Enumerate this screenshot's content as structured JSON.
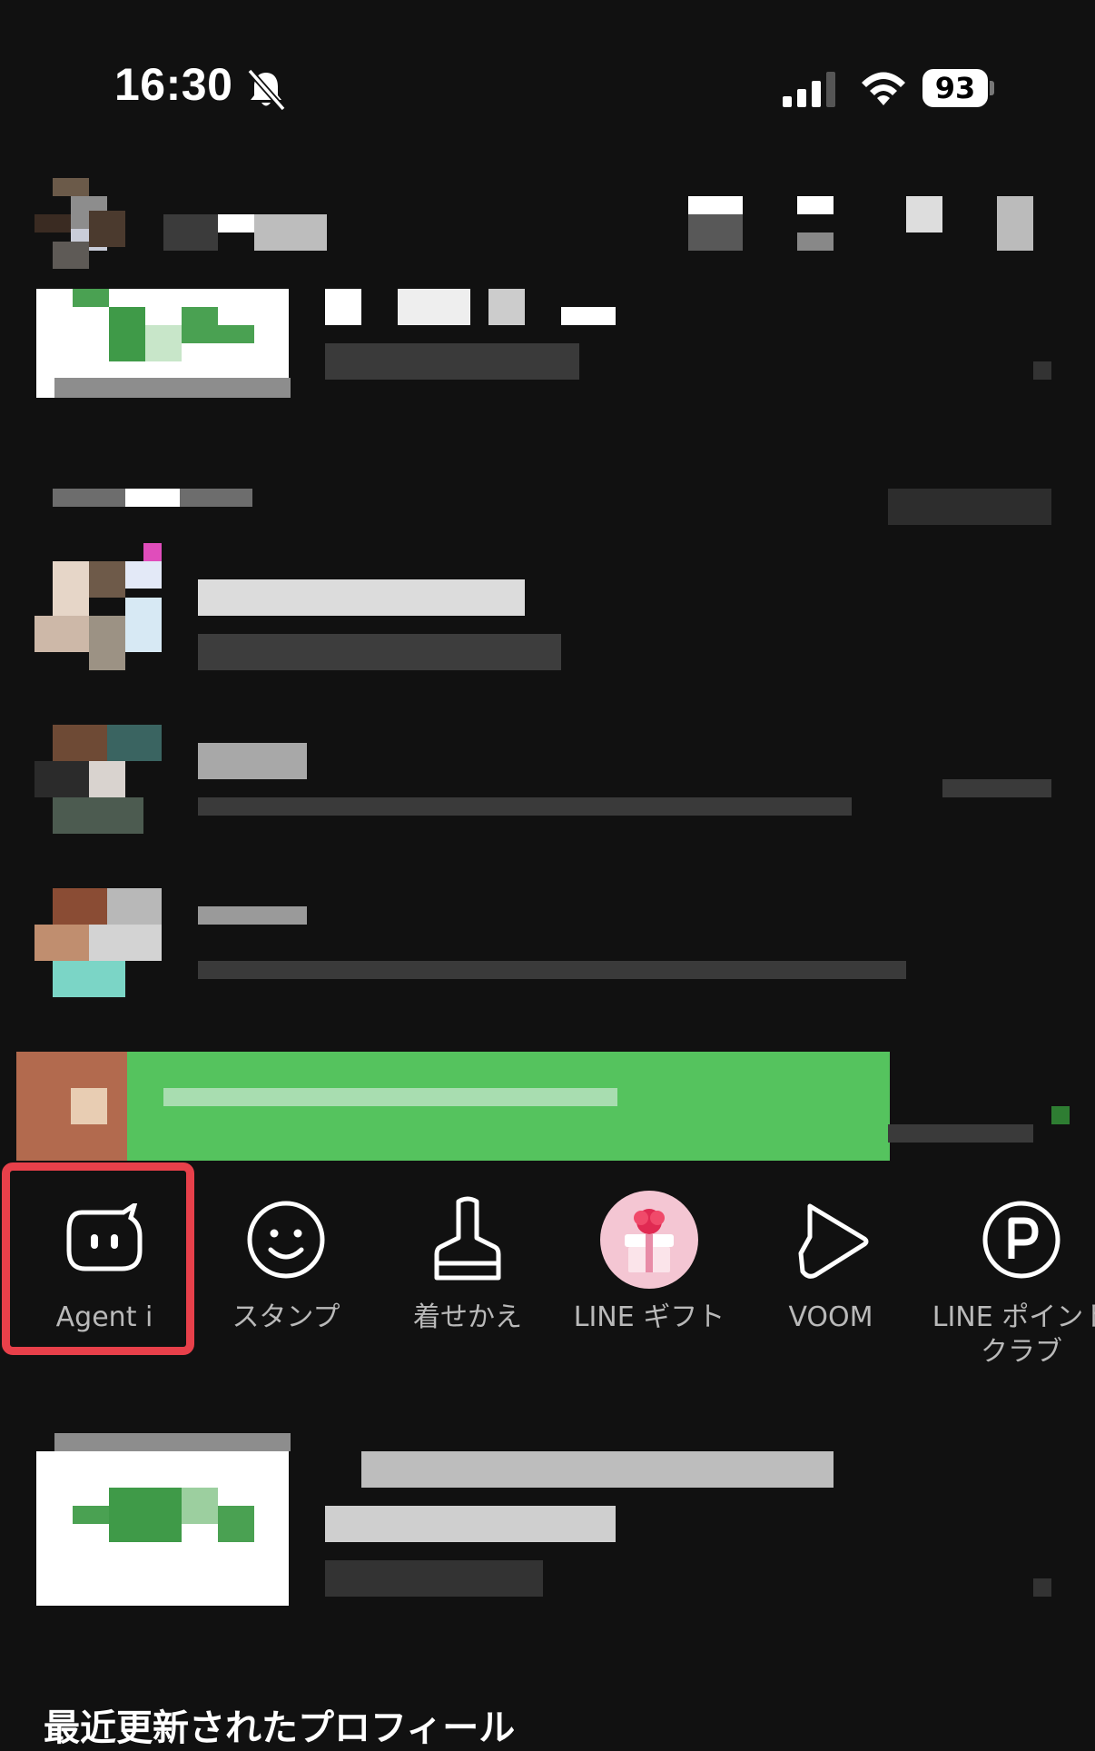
{
  "status_bar": {
    "time": "16:30",
    "battery": "93"
  },
  "services": [
    {
      "label": "Agent i",
      "icon": "agent-i-icon"
    },
    {
      "label": "スタンプ",
      "icon": "smiley-icon"
    },
    {
      "label": "着せかえ",
      "icon": "brush-icon"
    },
    {
      "label": "LINE ギフト",
      "icon": "gift-icon"
    },
    {
      "label": "VOOM",
      "icon": "voom-play-icon"
    },
    {
      "label": "LINE ポイントクラブ",
      "icon": "points-icon"
    }
  ],
  "section_header": "最近更新されたプロフィール",
  "colors": {
    "background": "#111111",
    "highlight": "#e8404a",
    "line_green": "#55c35e",
    "gift_bg": "#f4c6d3"
  }
}
